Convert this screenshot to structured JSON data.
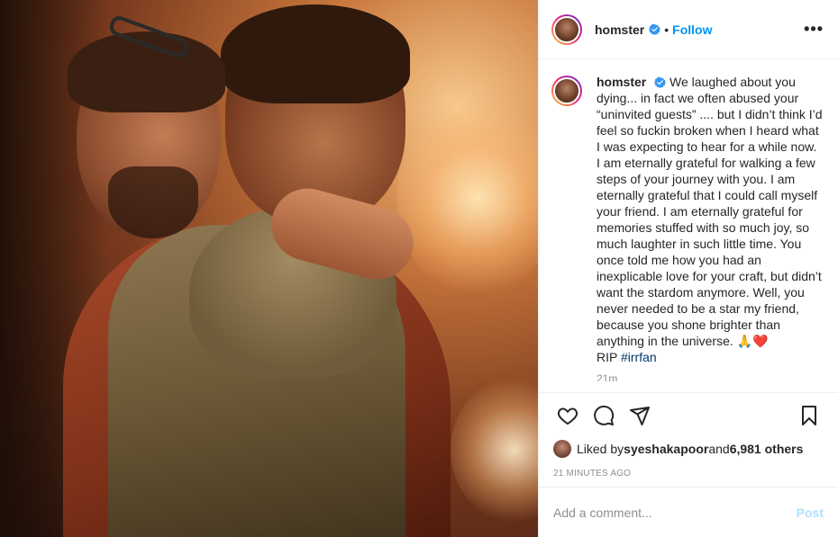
{
  "post": {
    "username": "homster",
    "follow_label": "Follow",
    "dot": "•",
    "more_label": "•••"
  },
  "caption": {
    "username": "homster",
    "text": "We laughed about you dying... in fact we often abused your “uninvited guests” .... but I didn’t think I’d feel so fuckin broken when I heard what I was expecting to hear for a while now. I am eternally grateful for walking a few steps of your journey with you. I am eternally grateful that I could call myself your friend. I am eternally grateful for memories stuffed with so much joy, so much laughter in such little time. You once told me how you had an inexplicable love for your craft, but didn’t want the stardom anymore. Well, you never needed to be a star my friend, because you shone brighter than anything in the universe. 🙏❤️",
    "rip_prefix": "RIP ",
    "hashtag": "#irrfan",
    "time_short": "21m"
  },
  "likes": {
    "prefix": "Liked by ",
    "user": "syeshakapoor",
    "middle": " and ",
    "others": "6,981 others"
  },
  "time_ago": "21 MINUTES AGO",
  "comment": {
    "placeholder": "Add a comment...",
    "post_label": "Post"
  },
  "icons": {
    "verified": "verified-badge-icon",
    "like": "heart-icon",
    "comment": "comment-bubble-icon",
    "share": "paper-plane-icon",
    "save": "bookmark-icon"
  },
  "colors": {
    "link_blue": "#0095f6",
    "hashtag": "#00376b",
    "muted": "#8e8e8e",
    "post_disabled": "#b2dffc"
  }
}
